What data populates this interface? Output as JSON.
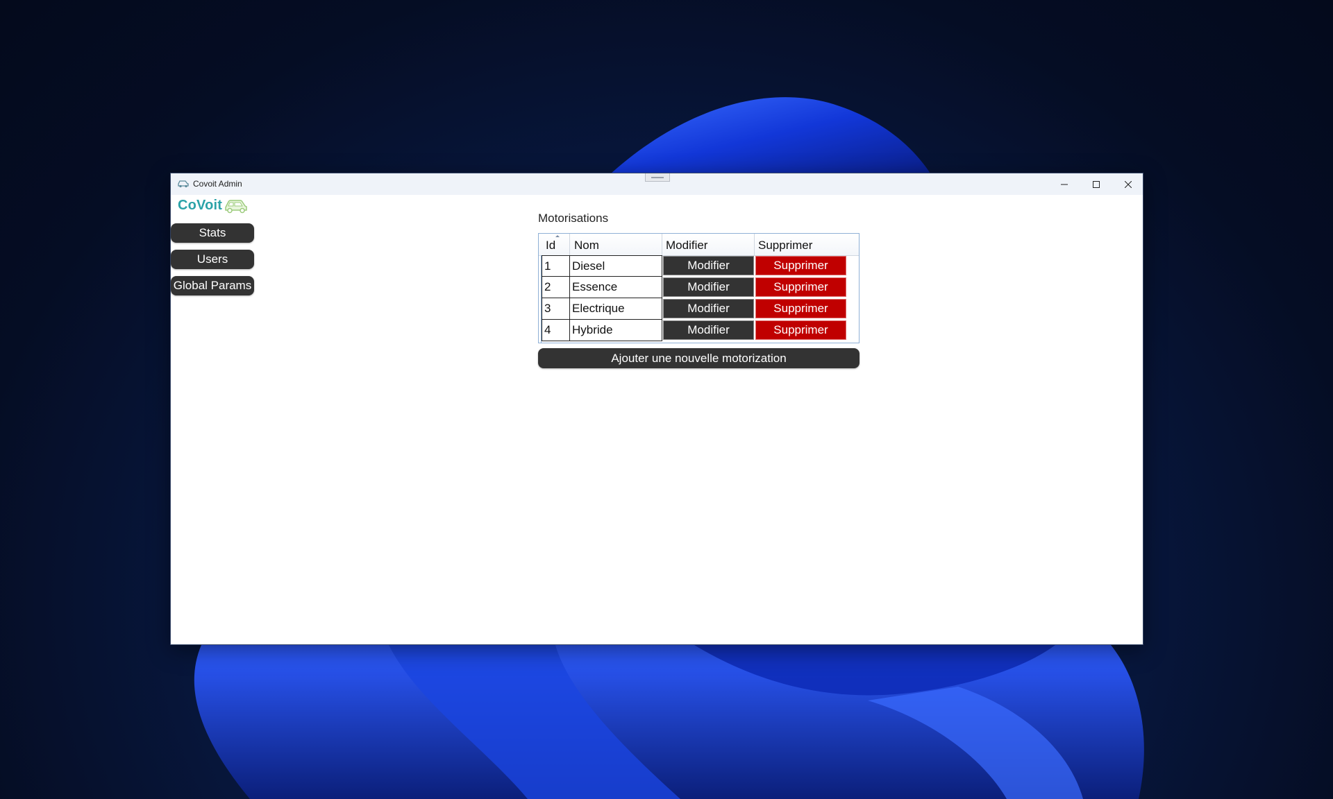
{
  "window": {
    "title": "Covoit Admin"
  },
  "logo": {
    "text": "CoVoit",
    "icon": "car-icon"
  },
  "sidebar": {
    "items": [
      {
        "label": "Stats"
      },
      {
        "label": "Users"
      },
      {
        "label": "Global Params"
      }
    ]
  },
  "main": {
    "title": "Motorisations",
    "table": {
      "columns": [
        "Id",
        "Nom",
        "Modifier",
        "Supprimer"
      ],
      "rows": [
        {
          "id": "1",
          "nom": "Diesel",
          "modifier": "Modifier",
          "supprimer": "Supprimer"
        },
        {
          "id": "2",
          "nom": "Essence",
          "modifier": "Modifier",
          "supprimer": "Supprimer"
        },
        {
          "id": "3",
          "nom": "Electrique",
          "modifier": "Modifier",
          "supprimer": "Supprimer"
        },
        {
          "id": "4",
          "nom": "Hybride",
          "modifier": "Modifier",
          "supprimer": "Supprimer"
        }
      ]
    },
    "add_button": "Ajouter une nouvelle motorization"
  },
  "colors": {
    "accent": "#2ba3a8",
    "button_dark": "#333333",
    "button_danger": "#c00000",
    "titlebar": "#eff3f9"
  }
}
